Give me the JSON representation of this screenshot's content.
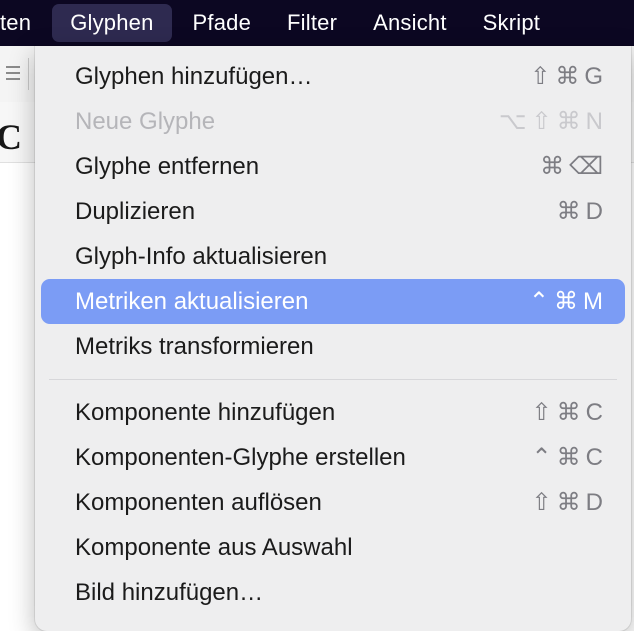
{
  "menubar": {
    "items": [
      {
        "label": "ten"
      },
      {
        "label": "Glyphen"
      },
      {
        "label": "Pfade"
      },
      {
        "label": "Filter"
      },
      {
        "label": "Ansicht"
      },
      {
        "label": "Skript"
      }
    ],
    "active_index": 1
  },
  "background": {
    "sample_glyph": "C"
  },
  "dropdown": {
    "groups": [
      [
        {
          "label": "Glyphen hinzufügen…",
          "shortcut": [
            "⇧",
            "⌘",
            "G"
          ],
          "disabled": false,
          "highlight": false
        },
        {
          "label": "Neue Glyphe",
          "shortcut": [
            "⌥",
            "⇧",
            "⌘",
            "N"
          ],
          "disabled": true,
          "highlight": false
        },
        {
          "label": "Glyphe entfernen",
          "shortcut": [
            "⌘",
            "⌫"
          ],
          "disabled": false,
          "highlight": false
        },
        {
          "label": "Duplizieren",
          "shortcut": [
            "⌘",
            "D"
          ],
          "disabled": false,
          "highlight": false
        },
        {
          "label": "Glyph-Info aktualisieren",
          "shortcut": [],
          "disabled": false,
          "highlight": false
        },
        {
          "label": "Metriken aktualisieren",
          "shortcut": [
            "⌃",
            "⌘",
            "M"
          ],
          "disabled": false,
          "highlight": true
        },
        {
          "label": "Metriks transformieren",
          "shortcut": [],
          "disabled": false,
          "highlight": false
        }
      ],
      [
        {
          "label": "Komponente hinzufügen",
          "shortcut": [
            "⇧",
            "⌘",
            "C"
          ],
          "disabled": false,
          "highlight": false
        },
        {
          "label": "Komponenten-Glyphe erstellen",
          "shortcut": [
            "⌃",
            "⌘",
            "C"
          ],
          "disabled": false,
          "highlight": false
        },
        {
          "label": "Komponenten auflösen",
          "shortcut": [
            "⇧",
            "⌘",
            "D"
          ],
          "disabled": false,
          "highlight": false
        },
        {
          "label": "Komponente aus Auswahl",
          "shortcut": [],
          "disabled": false,
          "highlight": false
        },
        {
          "label": "Bild hinzufügen…",
          "shortcut": [],
          "disabled": false,
          "highlight": false
        }
      ]
    ]
  }
}
